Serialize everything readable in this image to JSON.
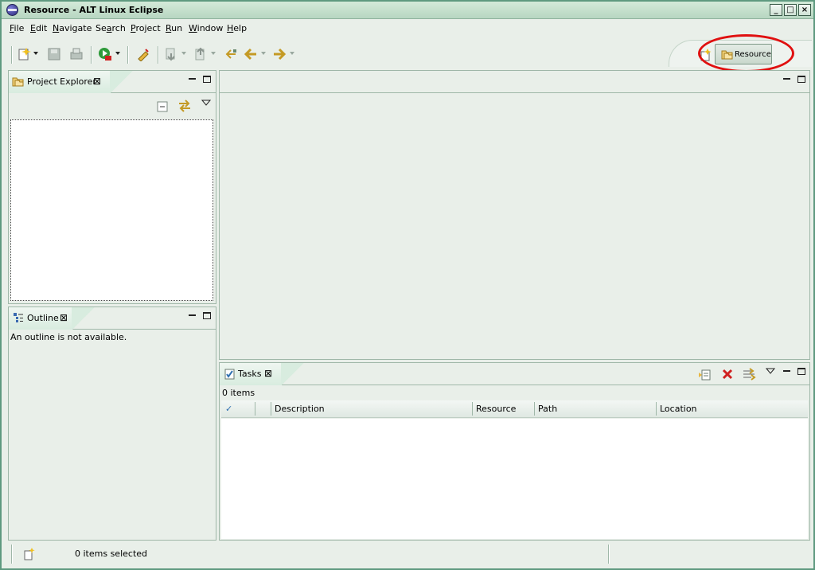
{
  "window": {
    "title": "Resource - ALT Linux Eclipse",
    "controls": {
      "minimize": "minimize-icon",
      "maximize": "maximize-icon",
      "close": "close-icon"
    }
  },
  "menu": [
    {
      "label": "File",
      "mnemonic": "F"
    },
    {
      "label": "Edit",
      "mnemonic": "E"
    },
    {
      "label": "Navigate",
      "mnemonic": "N"
    },
    {
      "label": "Search",
      "mnemonic": "a"
    },
    {
      "label": "Project",
      "mnemonic": "P"
    },
    {
      "label": "Run",
      "mnemonic": "R"
    },
    {
      "label": "Window",
      "mnemonic": "W"
    },
    {
      "label": "Help",
      "mnemonic": "H"
    }
  ],
  "toolbar": {
    "icons": [
      "new-wizard-icon",
      "save-icon",
      "print-icon",
      "run-icon",
      "open-task-icon",
      "next-annotation-icon",
      "previous-annotation-icon",
      "last-edit-location-icon",
      "back-icon",
      "forward-icon"
    ]
  },
  "perspective": {
    "active_label": "Resource",
    "open_icon": "open-perspective-icon",
    "active_icon": "resource-perspective-icon",
    "highlight_color": "#e01010"
  },
  "project_explorer": {
    "tab_label": "Project Explorer",
    "icons": [
      "collapse-all-icon",
      "link-with-editor-icon",
      "view-menu-icon"
    ]
  },
  "outline": {
    "tab_label": "Outline",
    "message": "An outline is not available."
  },
  "tasks": {
    "tab_label": "Tasks",
    "count_text": "0 items",
    "columns": [
      "✓",
      "",
      "Description",
      "Resource",
      "Path",
      "Location"
    ],
    "icons": [
      "new-task-icon",
      "delete-task-icon",
      "filter-icon",
      "view-menu-icon"
    ]
  },
  "status": {
    "text": "0 items selected",
    "icon": "fast-view-icon"
  },
  "colors": {
    "accent": "#5f9a80",
    "background": "#e9efe9",
    "tab_active": "#d8ecdf"
  }
}
